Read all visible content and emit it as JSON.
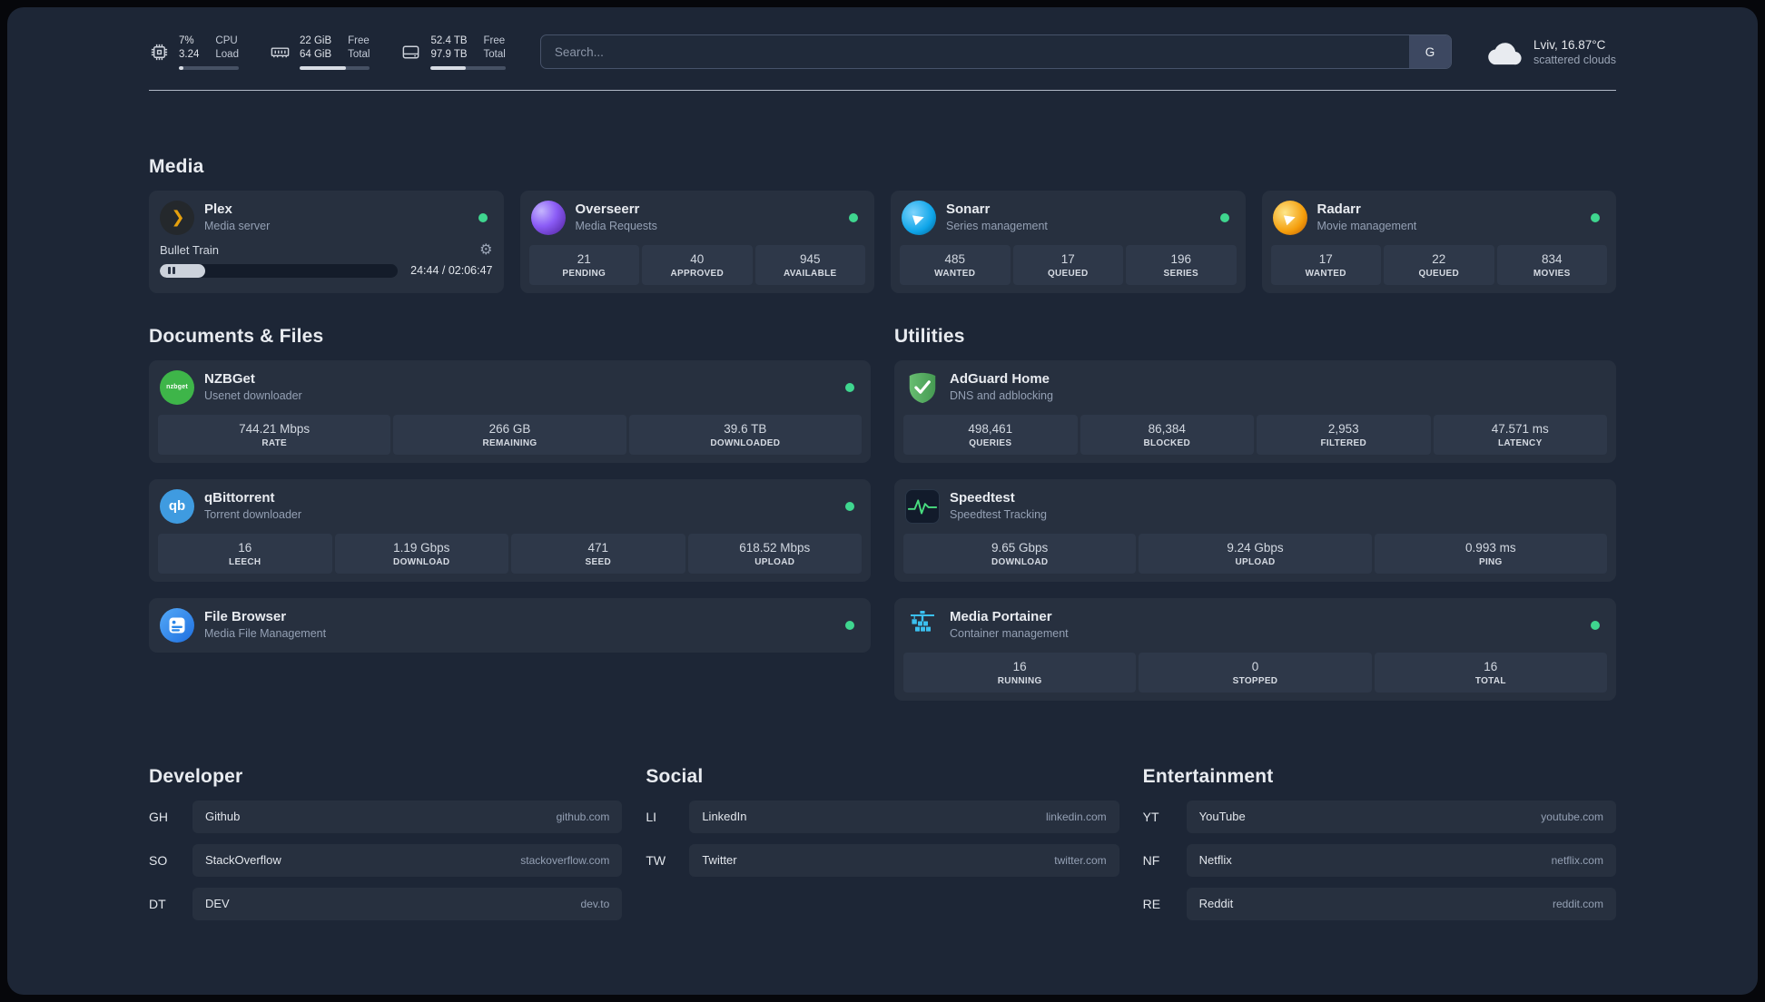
{
  "colors": {
    "background": "#1d2636",
    "card": "#27303f",
    "stat_block": "#2e3849",
    "status_online": "#3fd68f",
    "plex_gold": "#e5a00d",
    "text_primary": "#e5e7eb",
    "text_secondary": "#94a0b4"
  },
  "topbar": {
    "cpu": {
      "value_top": "7%",
      "value_bottom": "3.24",
      "label_top": "CPU",
      "label_bottom": "Load",
      "bar_percent": 7
    },
    "memory": {
      "value_top": "22 GiB",
      "value_bottom": "64 GiB",
      "label_top": "Free",
      "label_bottom": "Total",
      "bar_percent": 66
    },
    "disk": {
      "value_top": "52.4 TB",
      "value_bottom": "97.9 TB",
      "label_top": "Free",
      "label_bottom": "Total",
      "bar_percent": 47
    },
    "search": {
      "placeholder": "Search...",
      "provider": "G"
    },
    "weather": {
      "location": "Lviv, 16.87°C",
      "condition": "scattered clouds"
    }
  },
  "icons": {
    "gear": "⚙",
    "plex_glyph": "❯",
    "sonarr_glyph": "▶",
    "radarr_glyph": "▶",
    "nzbget_label": "nzbget",
    "qbittorrent_label": "qb"
  },
  "media": {
    "title": "Media",
    "plex": {
      "name": "Plex",
      "desc": "Media server",
      "now_playing": "Bullet Train",
      "time": "24:44 / 02:06:47",
      "progress_percent": 19
    },
    "overseerr": {
      "name": "Overseerr",
      "desc": "Media Requests",
      "stats": [
        {
          "value": "21",
          "label": "PENDING"
        },
        {
          "value": "40",
          "label": "APPROVED"
        },
        {
          "value": "945",
          "label": "AVAILABLE"
        }
      ]
    },
    "sonarr": {
      "name": "Sonarr",
      "desc": "Series management",
      "stats": [
        {
          "value": "485",
          "label": "WANTED"
        },
        {
          "value": "17",
          "label": "QUEUED"
        },
        {
          "value": "196",
          "label": "SERIES"
        }
      ]
    },
    "radarr": {
      "name": "Radarr",
      "desc": "Movie management",
      "stats": [
        {
          "value": "17",
          "label": "WANTED"
        },
        {
          "value": "22",
          "label": "QUEUED"
        },
        {
          "value": "834",
          "label": "MOVIES"
        }
      ]
    }
  },
  "documents": {
    "title": "Documents & Files",
    "nzbget": {
      "name": "NZBGet",
      "desc": "Usenet downloader",
      "stats": [
        {
          "value": "744.21 Mbps",
          "label": "RATE"
        },
        {
          "value": "266 GB",
          "label": "REMAINING"
        },
        {
          "value": "39.6 TB",
          "label": "DOWNLOADED"
        }
      ]
    },
    "qbittorrent": {
      "name": "qBittorrent",
      "desc": "Torrent downloader",
      "stats": [
        {
          "value": "16",
          "label": "LEECH"
        },
        {
          "value": "1.19 Gbps",
          "label": "DOWNLOAD"
        },
        {
          "value": "471",
          "label": "SEED"
        },
        {
          "value": "618.52 Mbps",
          "label": "UPLOAD"
        }
      ]
    },
    "filebrowser": {
      "name": "File Browser",
      "desc": "Media File Management"
    }
  },
  "utilities": {
    "title": "Utilities",
    "adguard": {
      "name": "AdGuard Home",
      "desc": "DNS and adblocking",
      "stats": [
        {
          "value": "498,461",
          "label": "QUERIES"
        },
        {
          "value": "86,384",
          "label": "BLOCKED"
        },
        {
          "value": "2,953",
          "label": "FILTERED"
        },
        {
          "value": "47.571 ms",
          "label": "LATENCY"
        }
      ]
    },
    "speedtest": {
      "name": "Speedtest",
      "desc": "Speedtest Tracking",
      "stats": [
        {
          "value": "9.65 Gbps",
          "label": "DOWNLOAD"
        },
        {
          "value": "9.24 Gbps",
          "label": "UPLOAD"
        },
        {
          "value": "0.993 ms",
          "label": "PING"
        }
      ]
    },
    "portainer": {
      "name": "Media Portainer",
      "desc": "Container management",
      "stats": [
        {
          "value": "16",
          "label": "RUNNING"
        },
        {
          "value": "0",
          "label": "STOPPED"
        },
        {
          "value": "16",
          "label": "TOTAL"
        }
      ]
    }
  },
  "bookmarks": {
    "developer": {
      "title": "Developer",
      "items": [
        {
          "abbr": "GH",
          "name": "Github",
          "domain": "github.com"
        },
        {
          "abbr": "SO",
          "name": "StackOverflow",
          "domain": "stackoverflow.com"
        },
        {
          "abbr": "DT",
          "name": "DEV",
          "domain": "dev.to"
        }
      ]
    },
    "social": {
      "title": "Social",
      "items": [
        {
          "abbr": "LI",
          "name": "LinkedIn",
          "domain": "linkedin.com"
        },
        {
          "abbr": "TW",
          "name": "Twitter",
          "domain": "twitter.com"
        }
      ]
    },
    "entertainment": {
      "title": "Entertainment",
      "items": [
        {
          "abbr": "YT",
          "name": "YouTube",
          "domain": "youtube.com"
        },
        {
          "abbr": "NF",
          "name": "Netflix",
          "domain": "netflix.com"
        },
        {
          "abbr": "RE",
          "name": "Reddit",
          "domain": "reddit.com"
        }
      ]
    }
  }
}
